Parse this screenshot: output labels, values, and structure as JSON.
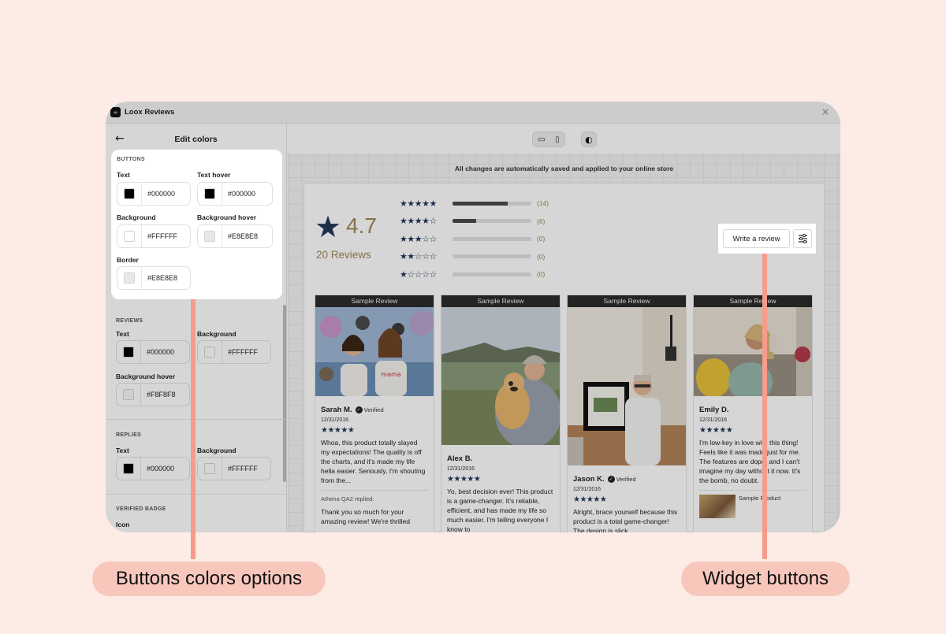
{
  "window": {
    "app_title": "Loox Reviews",
    "logo_text": "∞",
    "close_glyph": "×"
  },
  "sidebar": {
    "back_glyph": "←",
    "title": "Edit colors",
    "buttons": {
      "section": "BUTTONS",
      "text_label": "Text",
      "text_value": "#000000",
      "text_color": "#000000",
      "text_hover_label": "Text hover",
      "text_hover_value": "#000000",
      "text_hover_color": "#000000",
      "background_label": "Background",
      "background_value": "#FFFFFF",
      "background_color": "#FFFFFF",
      "background_hover_label": "Background hover",
      "background_hover_value": "#E8E8E8",
      "background_hover_color": "#E8E8E8",
      "border_label": "Border",
      "border_value": "#E8E8E8",
      "border_color": "#E8E8E8"
    },
    "reviews": {
      "section": "REVIEWS",
      "text_label": "Text",
      "text_value": "#000000",
      "text_color": "#000000",
      "background_label": "Background",
      "background_value": "#FFFFFF",
      "background_color": "#FFFFFF",
      "background_hover_label": "Background hover",
      "background_hover_value": "#F8F8F8",
      "background_hover_color": "#F8F8F8"
    },
    "replies": {
      "section": "REPLIES",
      "text_label": "Text",
      "text_value": "#000000",
      "text_color": "#000000",
      "background_label": "Background",
      "background_value": "#FFFFFF",
      "background_color": "#FFFFFF"
    },
    "verified_badge": {
      "section": "VERIFIED BADGE",
      "icon_label": "Icon"
    }
  },
  "toolbar": {
    "desktop_icon": "▭",
    "mobile_icon": "▯",
    "theme_icon": "◐"
  },
  "autosave_notice": "All changes are automatically saved and applied to your online store",
  "summary": {
    "star_glyph": "★",
    "average": "4.7",
    "count_label": "20 Reviews",
    "distribution": [
      {
        "stars": "★★★★★",
        "count": "(14)",
        "share": 0.7
      },
      {
        "stars": "★★★★☆",
        "count": "(6)",
        "share": 0.3
      },
      {
        "stars": "★★★☆☆",
        "count": "(0)",
        "share": 0
      },
      {
        "stars": "★★☆☆☆",
        "count": "(0)",
        "share": 0
      },
      {
        "stars": "★☆☆☆☆",
        "count": "(0)",
        "share": 0
      }
    ]
  },
  "widget_buttons": {
    "write_review": "Write a review",
    "filter_icon": "⚙"
  },
  "reviews": [
    {
      "banner": "Sample Review",
      "name": "Sarah M.",
      "verified": "Verified",
      "date": "12/31/2016",
      "stars": "★★★★★",
      "text": "Whoa, this product totally slayed my expectations! The quality is off the charts, and it's made my life hella easier. Seriously, I'm shouting from the...",
      "reply_label": "Athena QA2 replied:",
      "reply_text": "Thank you so much for your amazing review! We're thrilled"
    },
    {
      "banner": "Sample Review",
      "name": "Alex B.",
      "date": "12/31/2016",
      "stars": "★★★★★",
      "text": "Yo, best decision ever! This product is a game-changer. It's reliable, efficient, and has made my life so much easier. I'm telling everyone I know to"
    },
    {
      "banner": "Sample Review",
      "name": "Jason K.",
      "verified": "Verified",
      "date": "12/31/2016",
      "stars": "★★★★★",
      "text": "Alright, brace yourself because this product is a total game-changer! The design is slick"
    },
    {
      "banner": "Sample Review",
      "name": "Emily D.",
      "date": "12/31/2016",
      "stars": "★★★★★",
      "text": "I'm low-key in love with this thing! Feels like it was made just for me. The features are dope, and I can't imagine my day without it now. It's the bomb, no doubt.",
      "product": "Sample Product"
    }
  ],
  "callouts": {
    "left": "Buttons colors options",
    "right": "Widget buttons"
  }
}
